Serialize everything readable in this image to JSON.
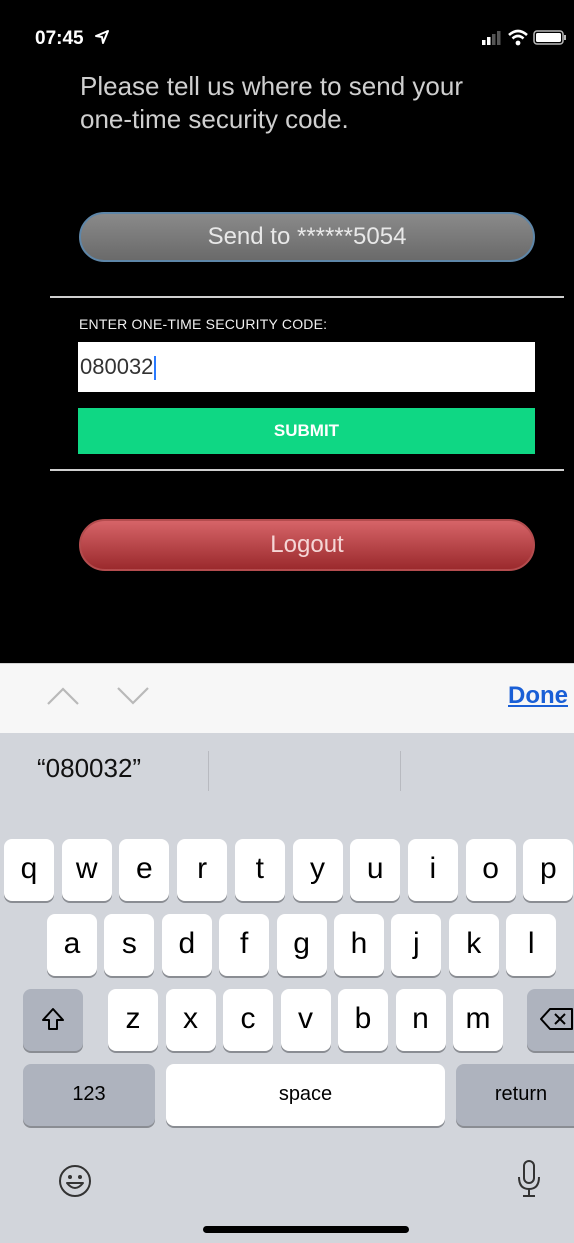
{
  "status_bar": {
    "time": "07:45"
  },
  "prompt": {
    "text": "Please tell us where to send your one-time security code."
  },
  "send_button": {
    "label": "Send to ******5054"
  },
  "code_section": {
    "label": "ENTER ONE-TIME SECURITY CODE:",
    "value": "080032"
  },
  "submit_button": {
    "label": "SUBMIT"
  },
  "logout_button": {
    "label": "Logout"
  },
  "keyboard_toolbar": {
    "done_label": "Done"
  },
  "keyboard": {
    "suggestion": "“080032”",
    "row1": [
      "q",
      "w",
      "e",
      "r",
      "t",
      "y",
      "u",
      "i",
      "o",
      "p"
    ],
    "row2": [
      "a",
      "s",
      "d",
      "f",
      "g",
      "h",
      "j",
      "k",
      "l"
    ],
    "row3": [
      "z",
      "x",
      "c",
      "v",
      "b",
      "n",
      "m"
    ],
    "numbers_label": "123",
    "space_label": "space",
    "return_label": "return"
  }
}
